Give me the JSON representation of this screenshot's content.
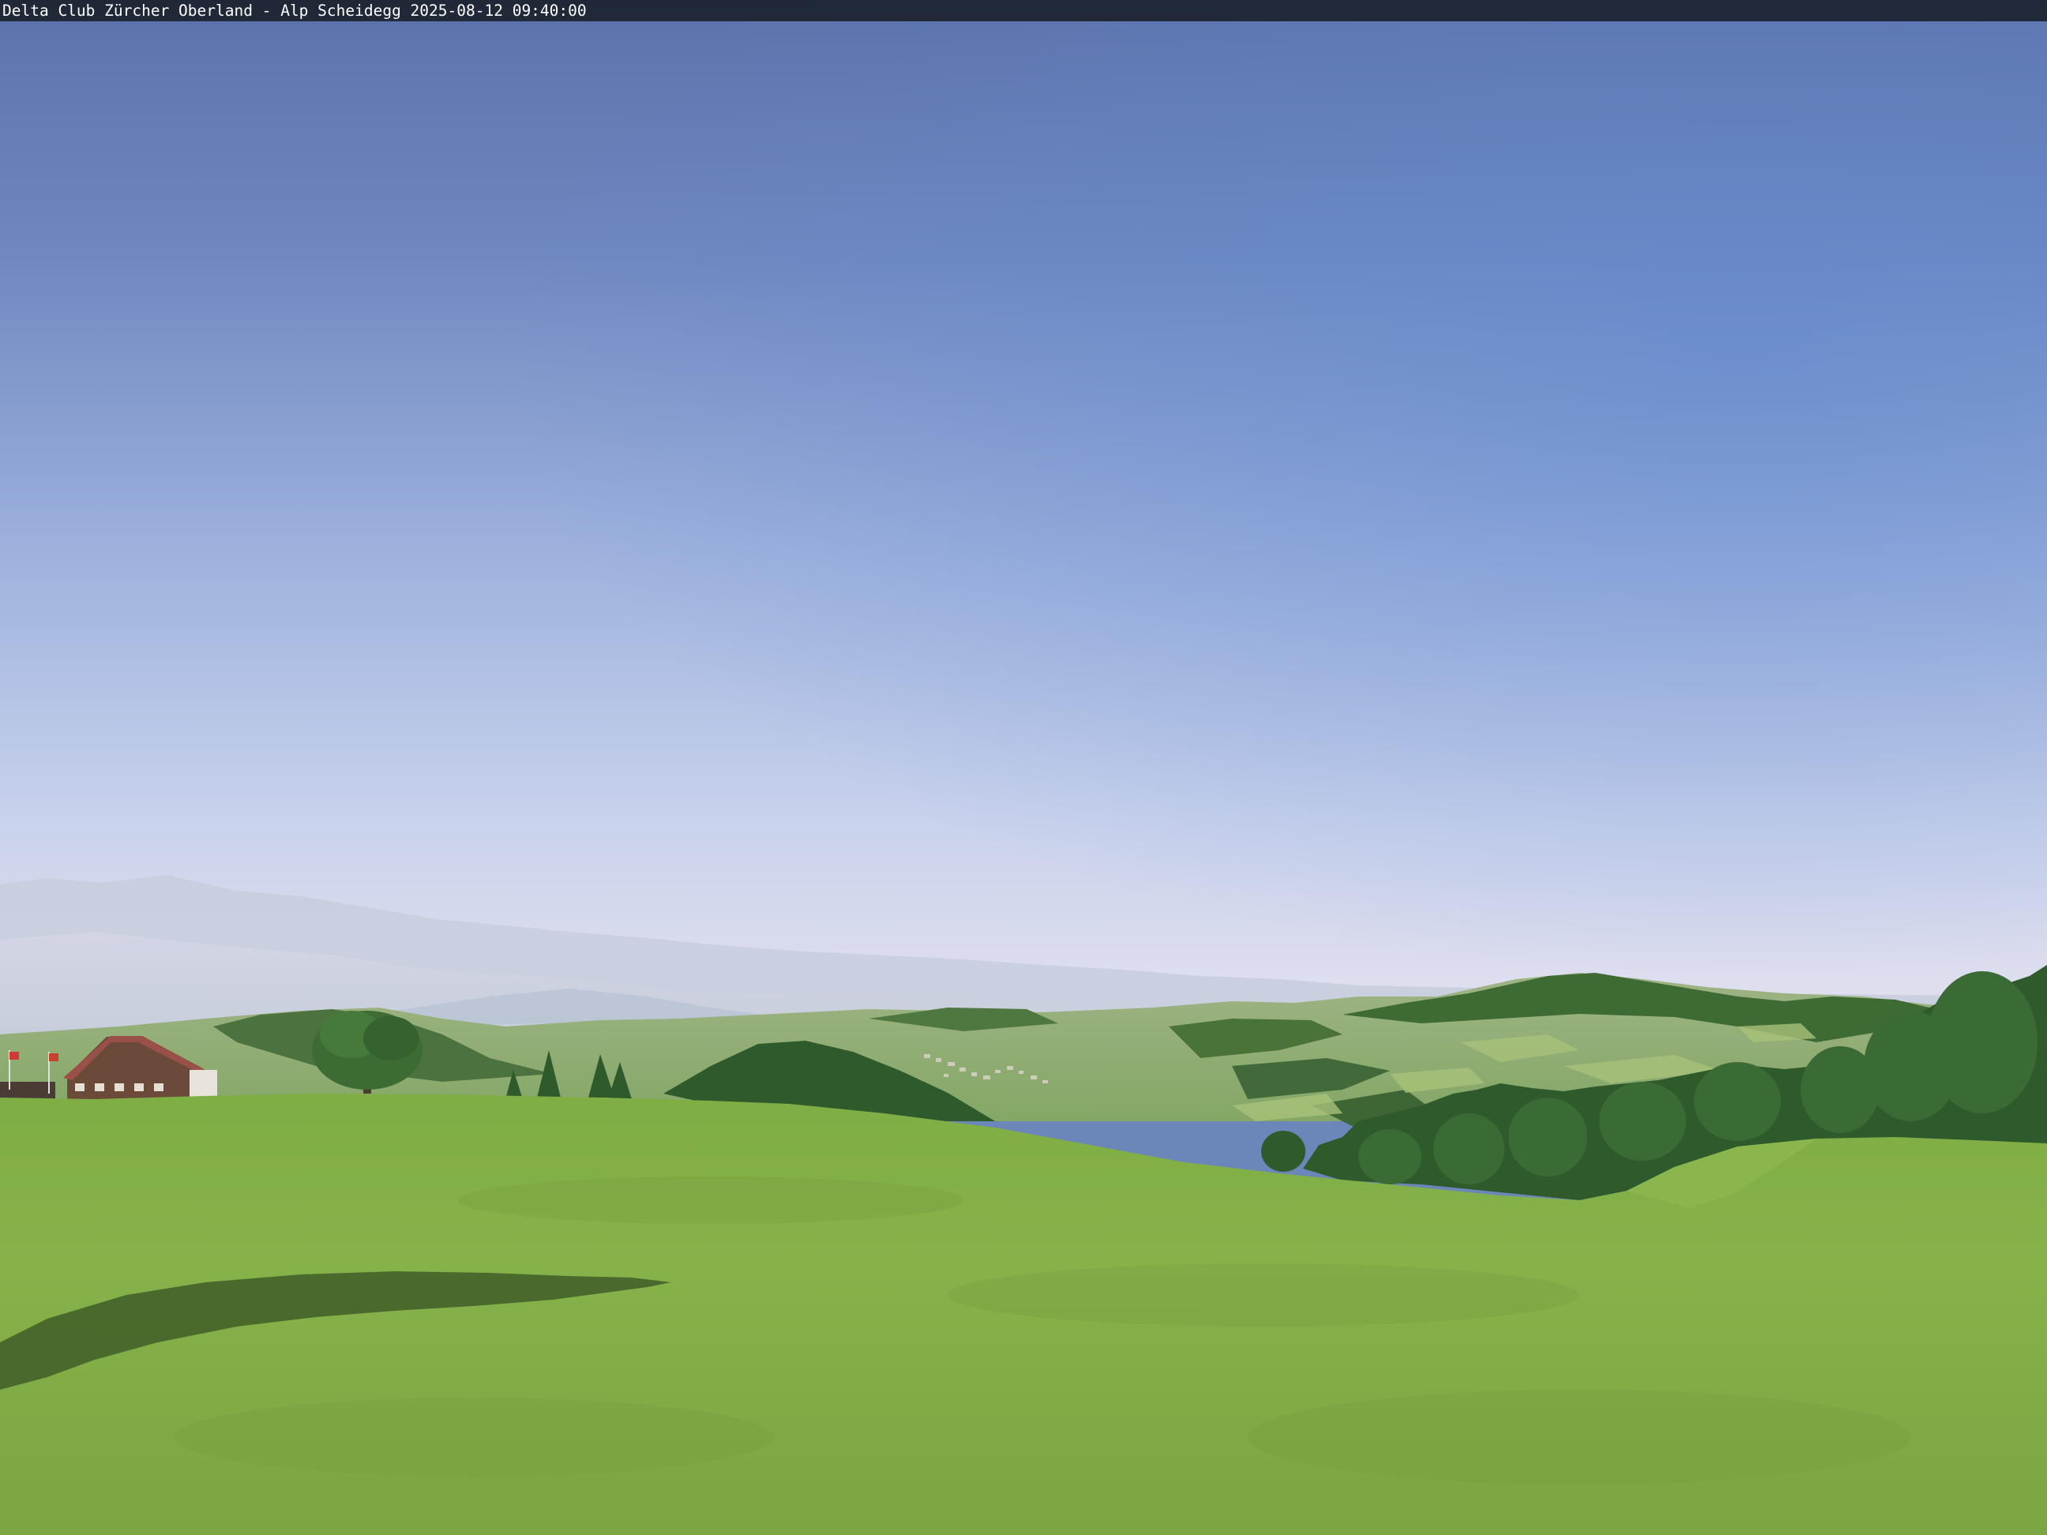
{
  "overlay": {
    "caption": "Delta Club Zürcher Oberland - Alp Scheidegg 2025-08-12 09:40:00"
  },
  "scene": {
    "sky_top_color": "#5f76ad",
    "sky_horizon_color": "#dfe0ef",
    "meadow_color": "#86b148",
    "forest_color": "#2f5a2c"
  }
}
